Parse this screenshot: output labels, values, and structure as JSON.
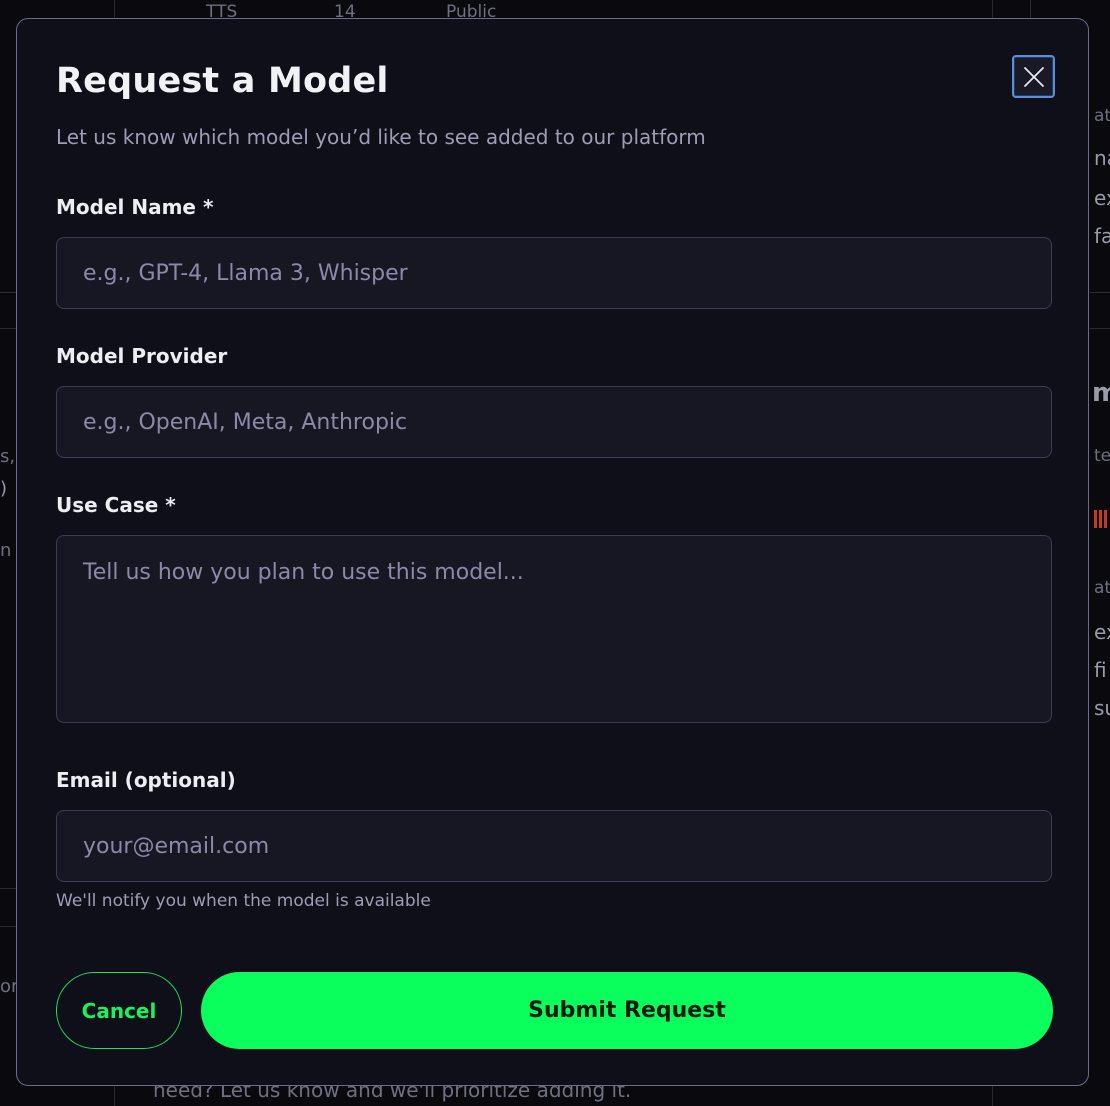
{
  "background": {
    "top_items": [
      "TTS",
      "14",
      "Public"
    ],
    "right_fragments": [
      "at",
      "na",
      "ex",
      "fa",
      "m",
      "te",
      "at",
      "ex",
      "fi",
      "su"
    ],
    "left_fragments": [
      "s,",
      ")",
      "n",
      "or"
    ],
    "bottom_text": "need? Let us know and we'll prioritize adding it."
  },
  "modal": {
    "title": "Request a Model",
    "subtitle": "Let us know which model you’d like to see added to our platform",
    "fields": {
      "model_name": {
        "label": "Model Name *",
        "placeholder": "e.g., GPT-4, Llama 3, Whisper",
        "value": ""
      },
      "model_provider": {
        "label": "Model Provider",
        "placeholder": "e.g., OpenAI, Meta, Anthropic",
        "value": ""
      },
      "use_case": {
        "label": "Use Case *",
        "placeholder": "Tell us how you plan to use this model...",
        "value": ""
      },
      "email": {
        "label": "Email (optional)",
        "placeholder": "your@email.com",
        "value": "",
        "hint": "We'll notify you when the model is available"
      }
    },
    "buttons": {
      "cancel": "Cancel",
      "submit": "Submit Request"
    }
  },
  "colors": {
    "accent": "#0afe5c",
    "modal_bg": "#0f0f1a",
    "focus_ring": "#5a8fd8"
  }
}
